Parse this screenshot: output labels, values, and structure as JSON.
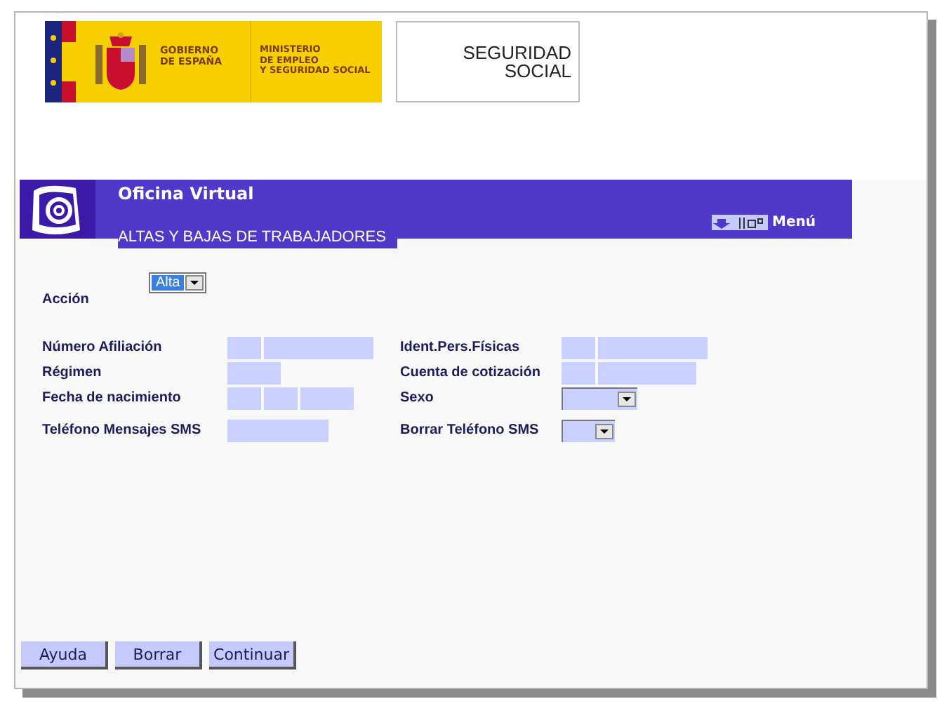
{
  "header": {
    "government_logo": {
      "line_1": "GOBIERNO",
      "line_2": "DE ESPAÑA"
    },
    "ministry_logo": {
      "lines": [
        "MINISTERIO",
        "DE EMPLEO",
        "Y SEGURIDAD SOCIAL"
      ]
    },
    "agency_logo": {
      "lines": [
        "SEGURIDAD",
        "SOCIAL"
      ]
    }
  },
  "banner": {
    "title": "Oficina Virtual",
    "subtitle": "ALTAS Y BAJAS DE TRABAJADORES",
    "menu": "Menú"
  },
  "action": {
    "label": "Acción",
    "value": "Alta"
  },
  "rows": [
    {
      "left": {
        "label": "Número Afiliación",
        "kind": "id"
      },
      "right": {
        "label": "Ident.Pers.Físicas",
        "kind": "id"
      }
    },
    {
      "left": {
        "label": "Régimen",
        "kind": "code"
      },
      "right": {
        "label": "Cuenta de cotización",
        "kind": "account"
      }
    },
    {
      "left": {
        "label": "Fecha de nacimiento",
        "kind": "date"
      },
      "right": {
        "label": "Sexo",
        "kind": "select"
      }
    },
    {
      "left": {
        "label": "Teléfono Mensajes SMS",
        "kind": "phone"
      },
      "right": {
        "label": "Borrar Teléfono SMS",
        "kind": "small-select"
      }
    }
  ],
  "buttons": [
    "Ayuda",
    "Borrar",
    "Continuar"
  ]
}
